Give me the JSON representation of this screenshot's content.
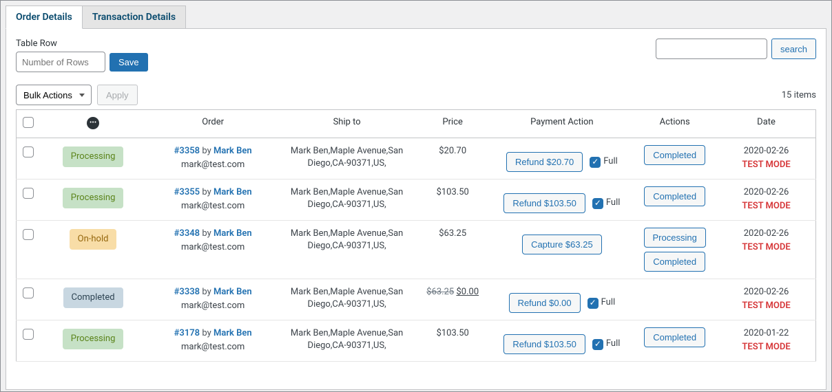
{
  "tabs": {
    "order_details": "Order Details",
    "transaction_details": "Transaction Details"
  },
  "controls": {
    "table_row_label": "Table Row",
    "number_rows_placeholder": "Number of Rows",
    "save_label": "Save",
    "search_label": "search",
    "bulk_actions_label": "Bulk Actions",
    "apply_label": "Apply",
    "items_count": "15 items"
  },
  "headers": {
    "order": "Order",
    "ship_to": "Ship to",
    "price": "Price",
    "payment_action": "Payment Action",
    "actions": "Actions",
    "date": "Date"
  },
  "common": {
    "by": "by",
    "full": "Full",
    "test_mode": "TEST MODE"
  },
  "rows": [
    {
      "status": "Processing",
      "status_class": "st-processing",
      "order_id": "#3358",
      "author": "Mark Ben",
      "email": "mark@test.com",
      "ship": "Mark Ben,Maple Avenue,San Diego,CA-90371,US,",
      "price": "$20.70",
      "price_strike": "",
      "price_ins": "",
      "payment_btn": "Refund $20.70",
      "show_full": true,
      "actions": [
        "Completed"
      ],
      "date": "2020-02-26"
    },
    {
      "status": "Processing",
      "status_class": "st-processing",
      "order_id": "#3355",
      "author": "Mark Ben",
      "email": "mark@test.com",
      "ship": "Mark Ben,Maple Avenue,San Diego,CA-90371,US,",
      "price": "$103.50",
      "price_strike": "",
      "price_ins": "",
      "payment_btn": "Refund $103.50",
      "show_full": true,
      "actions": [
        "Completed"
      ],
      "date": "2020-02-26"
    },
    {
      "status": "On-hold",
      "status_class": "st-on-hold",
      "order_id": "#3348",
      "author": "Mark Ben",
      "email": "mark@test.com",
      "ship": "Mark Ben,Maple Avenue,San Diego,CA-90371,US,",
      "price": "$63.25",
      "price_strike": "",
      "price_ins": "",
      "payment_btn": "Capture $63.25",
      "show_full": false,
      "actions": [
        "Processing",
        "Completed"
      ],
      "date": "2020-02-26"
    },
    {
      "status": "Completed",
      "status_class": "st-completed",
      "order_id": "#3338",
      "author": "Mark Ben",
      "email": "mark@test.com",
      "ship": "Mark Ben,Maple Avenue,San Diego,CA-90371,US,",
      "price": "",
      "price_strike": "$63.25",
      "price_ins": "$0.00",
      "payment_btn": "Refund $0.00",
      "show_full": true,
      "actions": [],
      "date": "2020-02-26"
    },
    {
      "status": "Processing",
      "status_class": "st-processing",
      "order_id": "#3178",
      "author": "Mark Ben",
      "email": "mark@test.com",
      "ship": "Mark Ben,Maple Avenue,San Diego,CA-90371,US,",
      "price": "$103.50",
      "price_strike": "",
      "price_ins": "",
      "payment_btn": "Refund $103.50",
      "show_full": true,
      "actions": [
        "Completed"
      ],
      "date": "2020-01-22"
    }
  ]
}
